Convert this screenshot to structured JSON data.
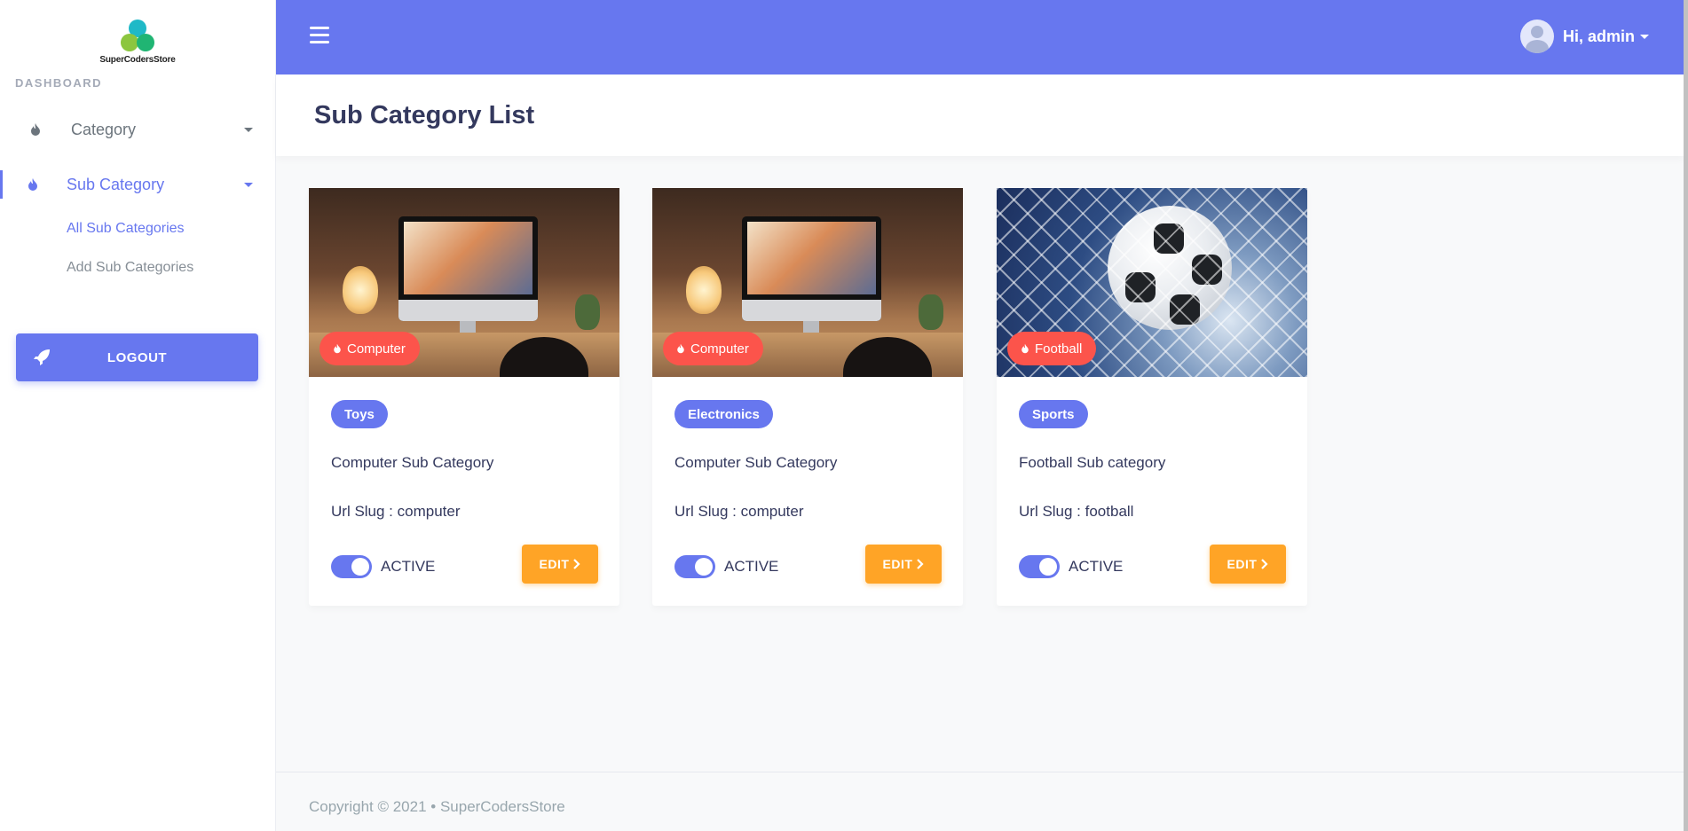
{
  "brand": {
    "name": "SuperCodersStore"
  },
  "sidebar": {
    "header": "DASHBOARD",
    "items": [
      {
        "label": "Category"
      },
      {
        "label": "Sub Category"
      }
    ],
    "sub_links": [
      {
        "label": "All Sub Categories"
      },
      {
        "label": "Add Sub Categories"
      }
    ],
    "logout_label": "LOGOUT"
  },
  "topbar": {
    "user_greeting": "Hi, admin"
  },
  "page": {
    "title": "Sub Category List"
  },
  "cards": [
    {
      "image_badge": "Computer",
      "tag": "Toys",
      "title": "Computer Sub Category",
      "slug": "Url Slug : computer",
      "status": "ACTIVE",
      "edit_label": "EDIT"
    },
    {
      "image_badge": "Computer",
      "tag": "Electronics",
      "title": "Computer Sub Category",
      "slug": "Url Slug : computer",
      "status": "ACTIVE",
      "edit_label": "EDIT"
    },
    {
      "image_badge": "Football",
      "tag": "Sports",
      "title": "Football Sub category",
      "slug": "Url Slug : football",
      "status": "ACTIVE",
      "edit_label": "EDIT"
    }
  ],
  "footer": {
    "text": "Copyright © 2021  •  SuperCodersStore"
  },
  "colors": {
    "primary": "#6777ef",
    "danger": "#fc544b",
    "warning": "#ffa426"
  }
}
